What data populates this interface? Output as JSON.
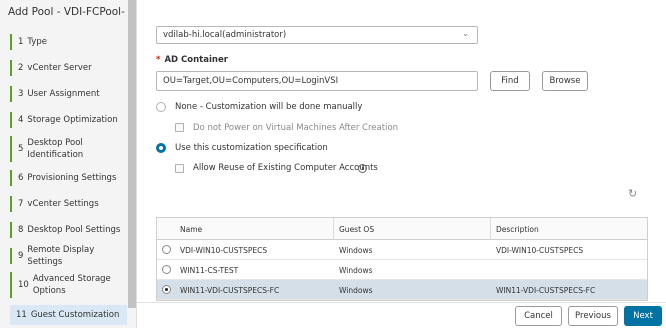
{
  "wizard": {
    "title": "Add Pool - VDI-FCPool-"
  },
  "steps": [
    {
      "num": "1",
      "label": "Type"
    },
    {
      "num": "2",
      "label": "vCenter Server"
    },
    {
      "num": "3",
      "label": "User Assignment"
    },
    {
      "num": "4",
      "label": "Storage Optimization"
    },
    {
      "num": "5",
      "label": "Desktop Pool Identification"
    },
    {
      "num": "6",
      "label": "Provisioning Settings"
    },
    {
      "num": "7",
      "label": "vCenter Settings"
    },
    {
      "num": "8",
      "label": "Desktop Pool Settings"
    },
    {
      "num": "9",
      "label": "Remote Display Settings"
    },
    {
      "num": "10",
      "label": "Advanced Storage Options"
    },
    {
      "num": "11",
      "label": "Guest Customization"
    }
  ],
  "domain_account": {
    "value": "vdilab-hi.local(administrator)"
  },
  "ad_container": {
    "label": "AD Container",
    "required_mark": "*",
    "value": "OU=Target,OU=Computers,OU=LoginVSI",
    "find_label": "Find",
    "browse_label": "Browse"
  },
  "options": {
    "none_label": "None - Customization will be done manually",
    "no_power_on_label": "Do not Power on Virtual Machines After Creation",
    "use_spec_label": "Use this customization specification",
    "allow_reuse_label": "Allow Reuse of Existing Computer Accounts",
    "info_icon": "info-icon"
  },
  "table": {
    "headers": [
      "Name",
      "Guest OS",
      "Description"
    ],
    "rows": [
      {
        "name": "VDI-WIN10-CUSTSPECS",
        "os": "Windows",
        "desc": "VDI-WIN10-CUSTSPECS"
      },
      {
        "name": "WIN11-CS-TEST",
        "os": "Windows",
        "desc": ""
      },
      {
        "name": "WIN11-VDI-CUSTSPECS-FC",
        "os": "Windows",
        "desc": "WIN11-VDI-CUSTSPECS-FC"
      }
    ]
  },
  "footer": {
    "cancel": "Cancel",
    "previous": "Previous",
    "next": "Next"
  },
  "colors": {
    "accent": "#0072a3",
    "step_done": "#5aa220",
    "selected_row": "#d4dfe7"
  }
}
